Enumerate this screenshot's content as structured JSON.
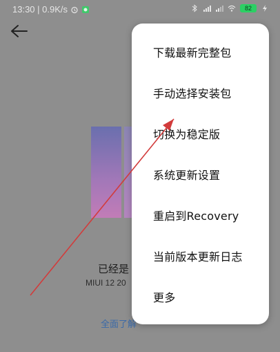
{
  "status_bar": {
    "time_speed": "13:30 | 0.9K/s",
    "battery": "82"
  },
  "background": {
    "title": "已经是",
    "version": "MIUI 12 20",
    "link": "全面了解"
  },
  "menu": {
    "items": [
      {
        "label": "下载最新完整包"
      },
      {
        "label": "手动选择安装包"
      },
      {
        "label": "切换为稳定版"
      },
      {
        "label": "系统更新设置"
      },
      {
        "label": "重启到Recovery"
      },
      {
        "label": "当前版本更新日志"
      },
      {
        "label": "更多"
      }
    ]
  },
  "colors": {
    "overlay_bg": "#8e8e8e",
    "menu_bg": "#ffffff",
    "annotation_arrow": "#d23b3b",
    "battery": "#2bd064"
  }
}
